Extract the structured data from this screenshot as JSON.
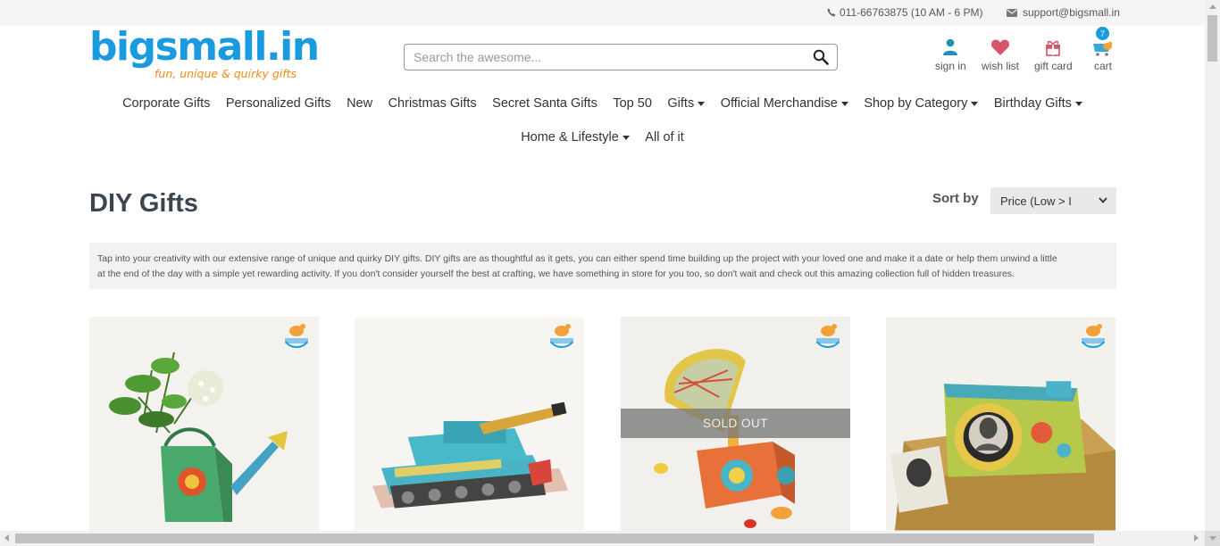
{
  "topbar": {
    "phone": "011-66763875 (10 AM - 6 PM)",
    "email": "support@bigsmall.in"
  },
  "logo": {
    "word": "bigsmall.in",
    "tagline": "fun, unique & quirky gifts"
  },
  "search": {
    "placeholder": "Search the awesome..."
  },
  "account": [
    {
      "label": "sign in",
      "icon": "user-icon"
    },
    {
      "label": "wish list",
      "icon": "heart-icon"
    },
    {
      "label": "gift card",
      "icon": "gift-icon"
    },
    {
      "label": "cart",
      "icon": "cart-icon"
    }
  ],
  "cart_count": "7",
  "nav_row1": [
    {
      "label": "Corporate Gifts",
      "dropdown": false
    },
    {
      "label": "Personalized Gifts",
      "dropdown": false
    },
    {
      "label": "New",
      "dropdown": false
    },
    {
      "label": "Christmas Gifts",
      "dropdown": false
    },
    {
      "label": "Secret Santa Gifts",
      "dropdown": false
    },
    {
      "label": "Top 50",
      "dropdown": false
    },
    {
      "label": "Gifts",
      "dropdown": true
    },
    {
      "label": "Official Merchandise",
      "dropdown": true
    },
    {
      "label": "Shop by Category",
      "dropdown": true
    },
    {
      "label": "Birthday Gifts",
      "dropdown": true
    }
  ],
  "nav_row2": [
    {
      "label": "Home & Lifestyle",
      "dropdown": true
    },
    {
      "label": "All of it",
      "dropdown": false
    }
  ],
  "page_title": "DIY Gifts",
  "sort": {
    "label": "Sort by",
    "selected": "Price (Low > I"
  },
  "description_lines": [
    "Tap into your creativity with our extensive range of unique and quirky DIY gifts. DIY gifts are as thoughtful as it gets, you can either spend time building up the project with your loved one and make it a date or help them unwind a little",
    "at the end of the day with a simple yet rewarding activity. If you don't consider yourself the best at crafting, we have something in store for you too, so don't wait and check out this amazing collection full of hidden treasures."
  ],
  "products": [
    {
      "image": "watering-can-planter",
      "sold_out": false
    },
    {
      "image": "paper-tank",
      "sold_out": false
    },
    {
      "image": "paper-gramophone",
      "sold_out": true,
      "sold_out_label": "SOLD OUT"
    },
    {
      "image": "paper-camera",
      "sold_out": false
    }
  ],
  "colors": {
    "brand_blue": "#1a9be0",
    "brand_orange": "#f28b1e",
    "icon_teal": "#1e8fb5",
    "icon_red": "#d9546b"
  }
}
